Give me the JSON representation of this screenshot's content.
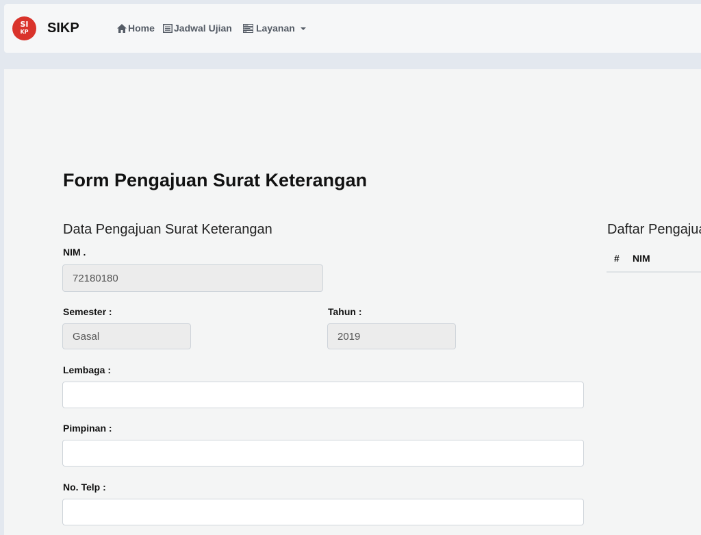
{
  "navbar": {
    "logo_top": "SI",
    "logo_bottom": "KP",
    "brand": "SIKP",
    "items": [
      {
        "label": "Home",
        "icon": "home-icon"
      },
      {
        "label": "Jadwal Ujian",
        "icon": "list-alt-icon"
      },
      {
        "label": "Layanan",
        "icon": "tasks-icon"
      }
    ]
  },
  "main": {
    "page_title": "Form Pengajuan Surat Keterangan",
    "form": {
      "section_title": "Data Pengajuan Surat Keterangan",
      "nim": {
        "label": "NIM .",
        "value": "72180180"
      },
      "semester": {
        "label": "Semester :",
        "value": "Gasal"
      },
      "tahun": {
        "label": "Tahun :",
        "value": "2019"
      },
      "lembaga": {
        "label": "Lembaga :",
        "value": ""
      },
      "pimpinan": {
        "label": "Pimpinan :",
        "value": ""
      },
      "telp": {
        "label": "No. Telp :",
        "value": ""
      }
    },
    "list": {
      "section_title": "Daftar Pengajuan",
      "columns": [
        "#",
        "NIM"
      ]
    }
  },
  "colors": {
    "brand_red": "#d9332b",
    "nav_text": "#555c66",
    "page_bg": "#e3e8ef"
  }
}
